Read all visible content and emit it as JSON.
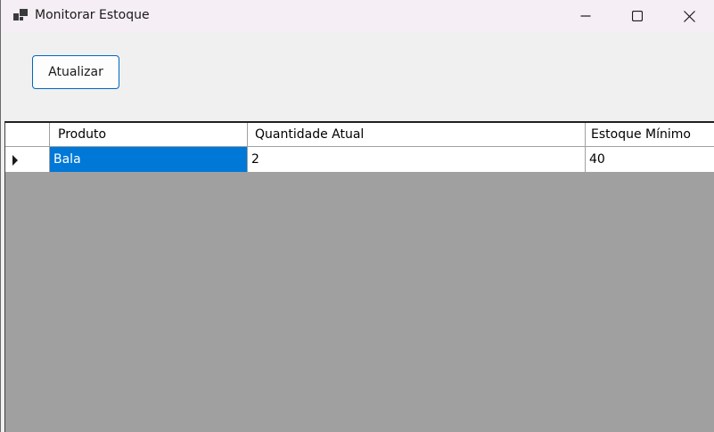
{
  "window": {
    "title": "Monitorar Estoque"
  },
  "toolbar": {
    "refresh_label": "Atualizar"
  },
  "grid": {
    "columns": [
      "Produto",
      "Quantidade Atual",
      "Estoque Mínimo"
    ],
    "rows": [
      {
        "produto": "Bala",
        "quantidade_atual": "2",
        "estoque_minimo": "40"
      }
    ]
  },
  "colors": {
    "selection": "#0078d7",
    "button_border": "#0067c0",
    "grid_background": "#a0a0a0"
  },
  "icons": [
    "app-icon",
    "minimize-icon",
    "maximize-icon",
    "close-icon",
    "current-row-indicator-icon"
  ]
}
